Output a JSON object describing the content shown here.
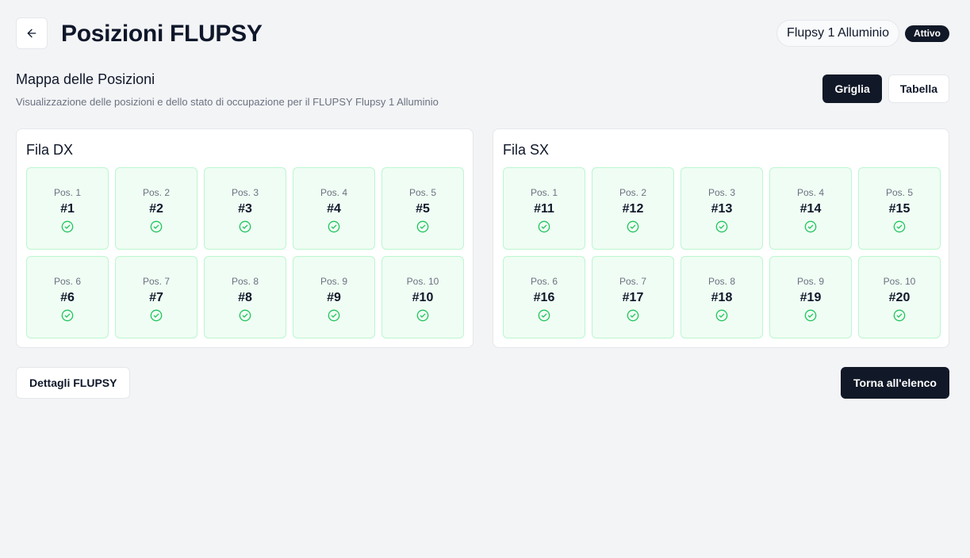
{
  "header": {
    "title": "Posizioni FLUPSY",
    "flupsy_name": "Flupsy 1 Alluminio",
    "status": "Attivo",
    "back_icon": "arrow-left-icon"
  },
  "section": {
    "title": "Mappa delle Posizioni",
    "description": "Visualizzazione delle posizioni e dello stato di occupazione per il FLUPSY Flupsy 1 Alluminio"
  },
  "view_toggle": {
    "grid_label": "Griglia",
    "table_label": "Tabella",
    "selected": "Griglia"
  },
  "rows": [
    {
      "title": "Fila DX",
      "cells": [
        {
          "pos": "Pos. 1",
          "num": "#1"
        },
        {
          "pos": "Pos. 2",
          "num": "#2"
        },
        {
          "pos": "Pos. 3",
          "num": "#3"
        },
        {
          "pos": "Pos. 4",
          "num": "#4"
        },
        {
          "pos": "Pos. 5",
          "num": "#5"
        },
        {
          "pos": "Pos. 6",
          "num": "#6"
        },
        {
          "pos": "Pos. 7",
          "num": "#7"
        },
        {
          "pos": "Pos. 8",
          "num": "#8"
        },
        {
          "pos": "Pos. 9",
          "num": "#9"
        },
        {
          "pos": "Pos. 10",
          "num": "#10"
        }
      ]
    },
    {
      "title": "Fila SX",
      "cells": [
        {
          "pos": "Pos. 1",
          "num": "#11"
        },
        {
          "pos": "Pos. 2",
          "num": "#12"
        },
        {
          "pos": "Pos. 3",
          "num": "#13"
        },
        {
          "pos": "Pos. 4",
          "num": "#14"
        },
        {
          "pos": "Pos. 5",
          "num": "#15"
        },
        {
          "pos": "Pos. 6",
          "num": "#16"
        },
        {
          "pos": "Pos. 7",
          "num": "#17"
        },
        {
          "pos": "Pos. 8",
          "num": "#18"
        },
        {
          "pos": "Pos. 9",
          "num": "#19"
        },
        {
          "pos": "Pos. 10",
          "num": "#20"
        }
      ]
    }
  ],
  "cell_icon": "check-circle-icon",
  "colors": {
    "accent": "#111827",
    "cell_bg": "#f0fdf4",
    "cell_border": "#bbf7d0",
    "check": "#22c55e"
  },
  "footer": {
    "details_label": "Dettagli FLUPSY",
    "back_label": "Torna all'elenco"
  }
}
